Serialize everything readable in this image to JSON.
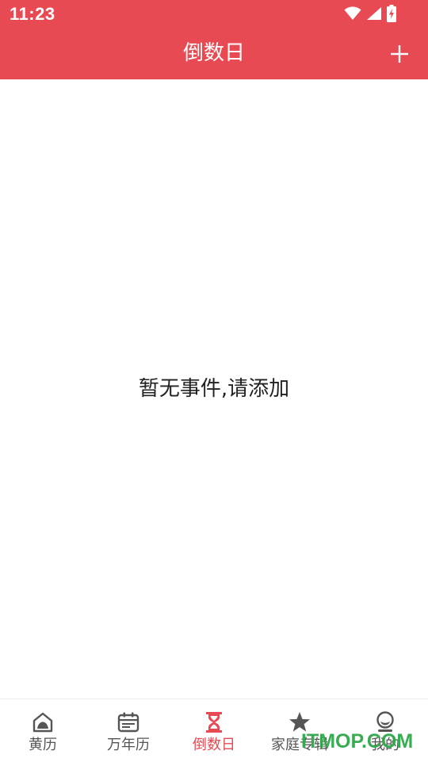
{
  "status_bar": {
    "time": "11:23",
    "icons": [
      "wifi-icon",
      "signal-icon",
      "battery-charging-icon"
    ]
  },
  "app_bar": {
    "title": "倒数日",
    "add_icon": "plus-icon"
  },
  "content": {
    "empty_message": "暂无事件,请添加"
  },
  "bottom_nav": {
    "active_index": 2,
    "items": [
      {
        "label": "黄历",
        "icon": "almanac-house-icon"
      },
      {
        "label": "万年历",
        "icon": "calendar-icon"
      },
      {
        "label": "倒数日",
        "icon": "hourglass-icon"
      },
      {
        "label": "家庭专辑",
        "icon": "star-icon"
      },
      {
        "label": "我的",
        "icon": "profile-icon"
      }
    ]
  },
  "watermark": {
    "text": "ITMOP.COM"
  },
  "colors": {
    "primary": "#e84a53",
    "nav_inactive": "#555555",
    "text_dark": "#222222",
    "watermark": "#2fa84a"
  }
}
